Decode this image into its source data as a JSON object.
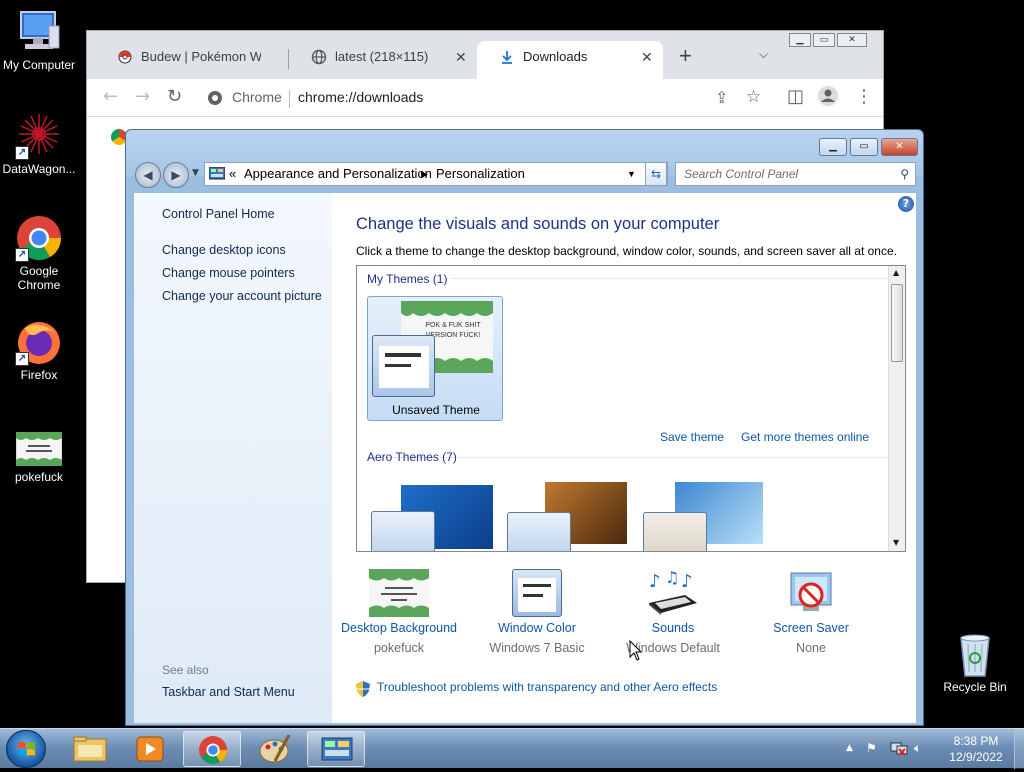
{
  "desktop": {
    "icons": [
      {
        "label": "My Computer"
      },
      {
        "label": "DataWagon..."
      },
      {
        "label": "Google Chrome"
      },
      {
        "label": "Firefox"
      },
      {
        "label": "pokefuck"
      },
      {
        "label": "Recycle Bin"
      }
    ]
  },
  "chrome": {
    "tabs": [
      {
        "label": "Budew | Pokémon Wiki"
      },
      {
        "label": "latest (218×115)"
      },
      {
        "label": "Downloads"
      }
    ],
    "new_tab": "+",
    "omnibox": {
      "scheme": "Chrome",
      "url": "chrome://downloads"
    }
  },
  "control_panel": {
    "breadcrumb": {
      "prefix": "«",
      "items": [
        "Appearance and Personalization",
        "Personalization"
      ]
    },
    "search_placeholder": "Search Control Panel",
    "sidebar": {
      "home": "Control Panel Home",
      "links": [
        "Change desktop icons",
        "Change mouse pointers",
        "Change your account picture"
      ],
      "see_also": "See also",
      "see_also_links": [
        "Taskbar and Start Menu"
      ]
    },
    "heading": "Change the visuals and sounds on your computer",
    "subheading": "Click a theme to change the desktop background, window color, sounds, and screen saver all at once.",
    "my_themes_label": "My Themes (1)",
    "unsaved_theme_label": "Unsaved Theme",
    "theme_thumb_text": "POK & FUK SHIT VERSION FUCK!",
    "save_theme": "Save theme",
    "get_more": "Get more themes online",
    "aero_label": "Aero Themes (7)",
    "bottom": [
      {
        "title": "Desktop Background",
        "value": "pokefuck"
      },
      {
        "title": "Window Color",
        "value": "Windows 7 Basic"
      },
      {
        "title": "Sounds",
        "value": "Windows Default"
      },
      {
        "title": "Screen Saver",
        "value": "None"
      }
    ],
    "troubleshoot": "Troubleshoot problems with transparency and other Aero effects"
  },
  "taskbar": {
    "time": "8:38 PM",
    "date": "12/9/2022"
  },
  "colors": {
    "link": "#0d57a6",
    "heading": "#1e3287",
    "taskbar": "#6e8fb5"
  }
}
